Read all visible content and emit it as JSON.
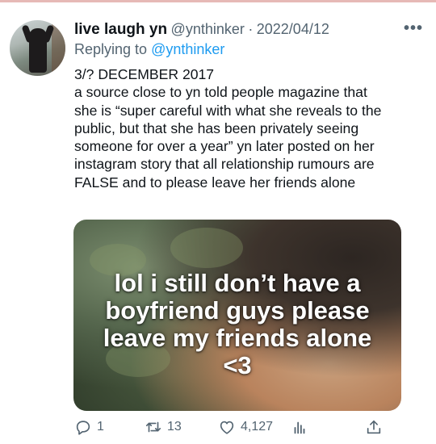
{
  "tweet": {
    "display_name": "live laugh yn",
    "handle": "@ynthinker",
    "separator": "·",
    "date": "2022/04/12",
    "more_label": "•••",
    "replying_prefix": "Replying to",
    "replying_to": "@ynthinker",
    "body_lines": [
      "3/? DECEMBER 2017",
      "a source close to yn told people magazine that",
      "she is “super careful with what she reveals to the",
      "public, but that she has been privately seeing",
      "someone for over a year” yn later posted on her",
      "instagram story that all relationship rumours are",
      "FALSE and to please leave her friends alone"
    ],
    "media": {
      "overlay_lines": [
        "lol i still don’t have a",
        "boyfriend guys please",
        "leave my friends alone",
        "<3"
      ]
    },
    "actions": {
      "reply_count": "1",
      "retweet_count": "13",
      "like_count": "4,127",
      "icons": [
        "reply-icon",
        "retweet-icon",
        "like-icon",
        "analytics-icon",
        "share-icon"
      ]
    }
  },
  "colors": {
    "text": "#0f1419",
    "secondary": "#536471",
    "accent": "#1d9bf0",
    "top_rule": "#e6b9b6"
  }
}
